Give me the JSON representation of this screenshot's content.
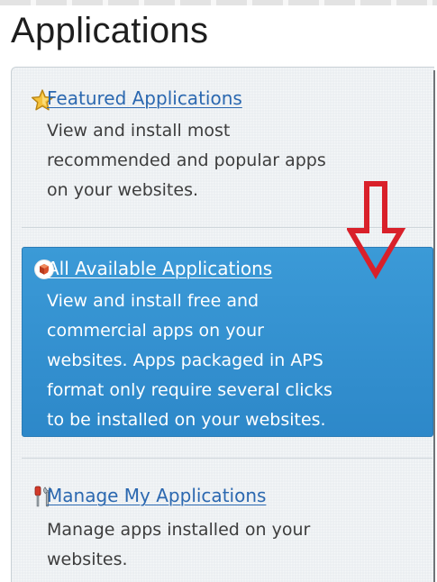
{
  "page": {
    "title": "Applications"
  },
  "items": [
    {
      "title": "Featured Applications",
      "icon": "star-icon",
      "description": [
        "View and install most",
        "recommended and popular apps",
        "on your websites."
      ]
    },
    {
      "title": "All Available Applications",
      "icon": "aps-package-icon",
      "selected": true,
      "description": [
        "View and install free and",
        "commercial apps on your",
        "websites. Apps packaged in APS",
        "format only require several clicks",
        "to be installed on your websites."
      ]
    },
    {
      "title": "Manage My Applications",
      "icon": "tools-icon",
      "description": [
        "Manage apps installed on your",
        "websites."
      ]
    }
  ],
  "annotation": {
    "arrow_color": "#d9202a",
    "arrow_icon": "down-arrow-annotation-icon"
  },
  "colors": {
    "link": "#2b68b0",
    "selected_background": "#3592d0",
    "panel_background": "#e9edf0"
  }
}
